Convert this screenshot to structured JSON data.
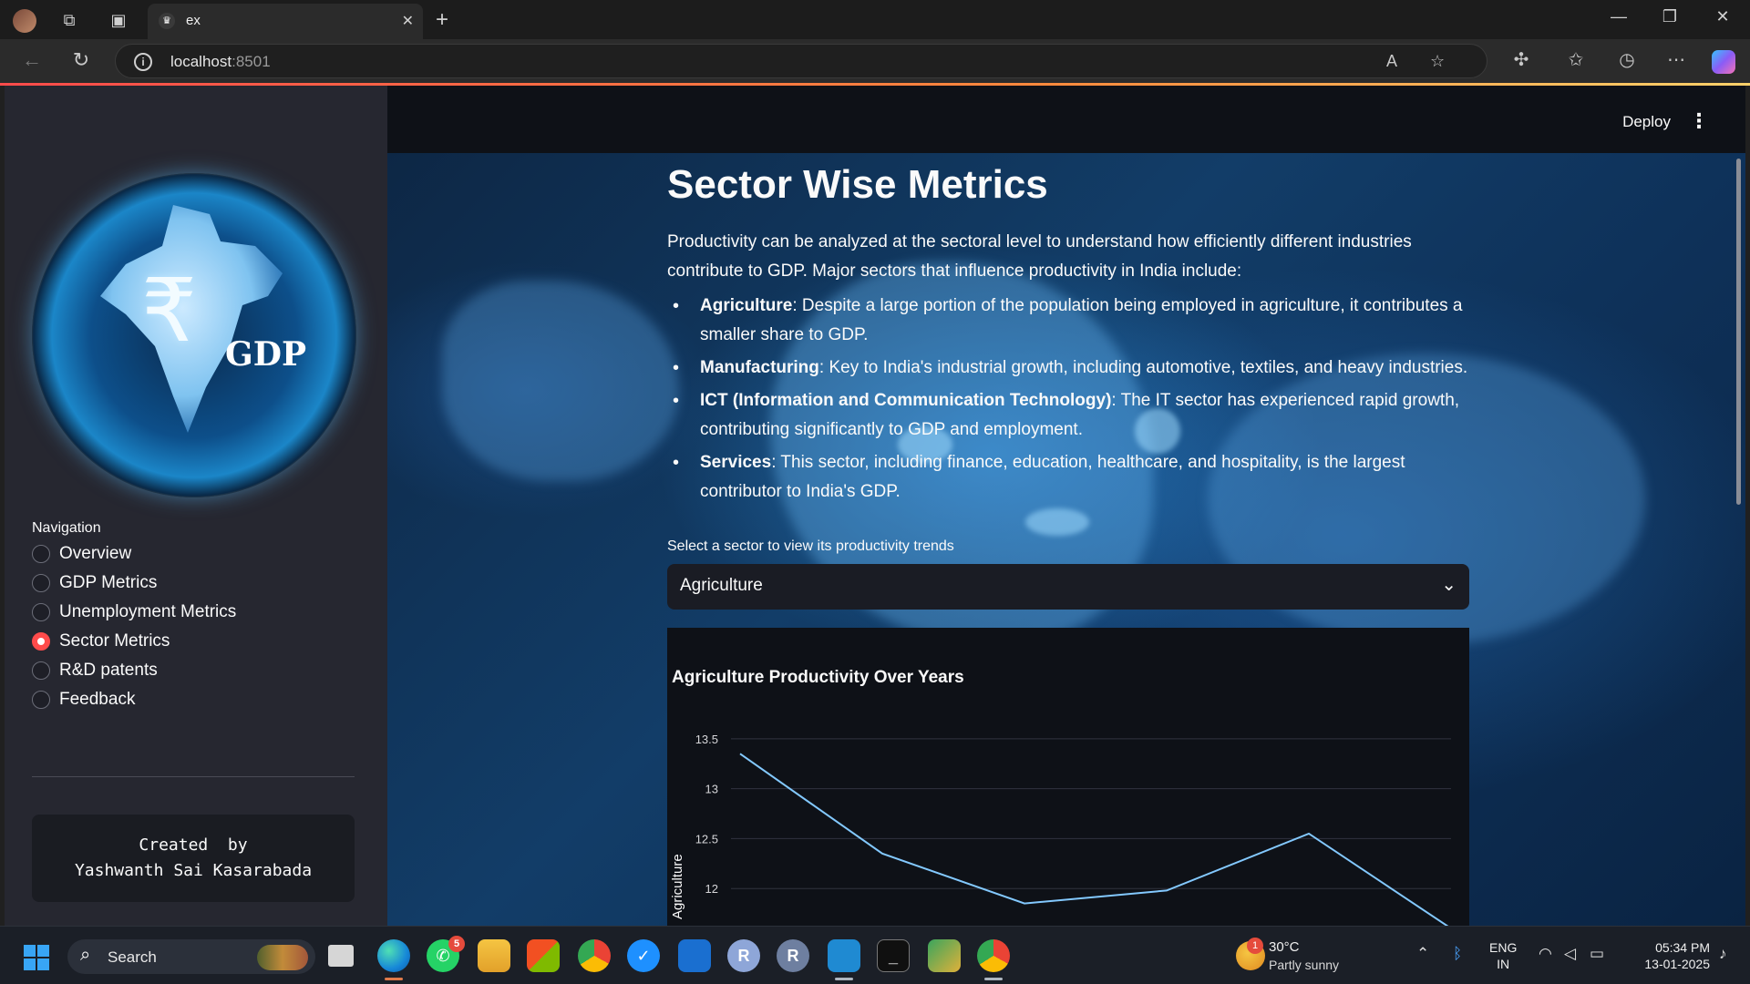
{
  "browser": {
    "tab_title": "ex",
    "url_host": "localhost",
    "url_port": ":8501"
  },
  "sidebar": {
    "logo_text": "GDP",
    "logo_symbol": "₹",
    "nav_title": "Navigation",
    "items": [
      {
        "label": "Overview",
        "selected": false
      },
      {
        "label": "GDP Metrics",
        "selected": false
      },
      {
        "label": "Unemployment Metrics",
        "selected": false
      },
      {
        "label": "Sector Metrics",
        "selected": true
      },
      {
        "label": "R&D patents",
        "selected": false
      },
      {
        "label": "Feedback",
        "selected": false
      }
    ],
    "credit_line1": "Created  by",
    "credit_line2": "Yashwanth Sai Kasarabada"
  },
  "header": {
    "deploy_label": "Deploy",
    "menu_icon": "⋮"
  },
  "main": {
    "title": "Sector Wise Metrics",
    "intro": "Productivity can be analyzed at the sectoral level to understand how efficiently different industries contribute to GDP. Major sectors that influence productivity in India include:",
    "bullets": [
      {
        "term": "Agriculture",
        "text": ": Despite a large portion of the population being employed in agriculture, it contributes a smaller share to GDP."
      },
      {
        "term": "Manufacturing",
        "text": ": Key to India's industrial growth, including automotive, textiles, and heavy industries."
      },
      {
        "term": "ICT (Information and Communication Technology)",
        "text": ": The IT sector has experienced rapid growth, contributing significantly to GDP and employment."
      },
      {
        "term": "Services",
        "text": ": This sector, including finance, education, healthcare, and hospitality, is the largest contributor to India's GDP."
      }
    ],
    "select_label": "Select a sector to view its productivity trends",
    "select_value": "Agriculture"
  },
  "chart_data": {
    "type": "line",
    "title": "Agriculture Productivity Over Years",
    "ylabel": "Agriculture",
    "xlabel": "",
    "yticks": [
      12,
      12.5,
      13,
      13.5
    ],
    "ylim": [
      11.6,
      13.7
    ],
    "series": [
      {
        "values": [
          13.35,
          12.35,
          11.85,
          11.98,
          12.55,
          11.6
        ]
      }
    ],
    "line_color": "#83c9ff",
    "grid": true
  },
  "taskbar": {
    "search_label": "Search",
    "whatsapp_badge": "5",
    "weather_badge": "1",
    "weather_temp": "30°C",
    "weather_desc": "Partly sunny",
    "lang_line1": "ENG",
    "lang_line2": "IN",
    "time": "05:34 PM",
    "date": "13-01-2025"
  }
}
